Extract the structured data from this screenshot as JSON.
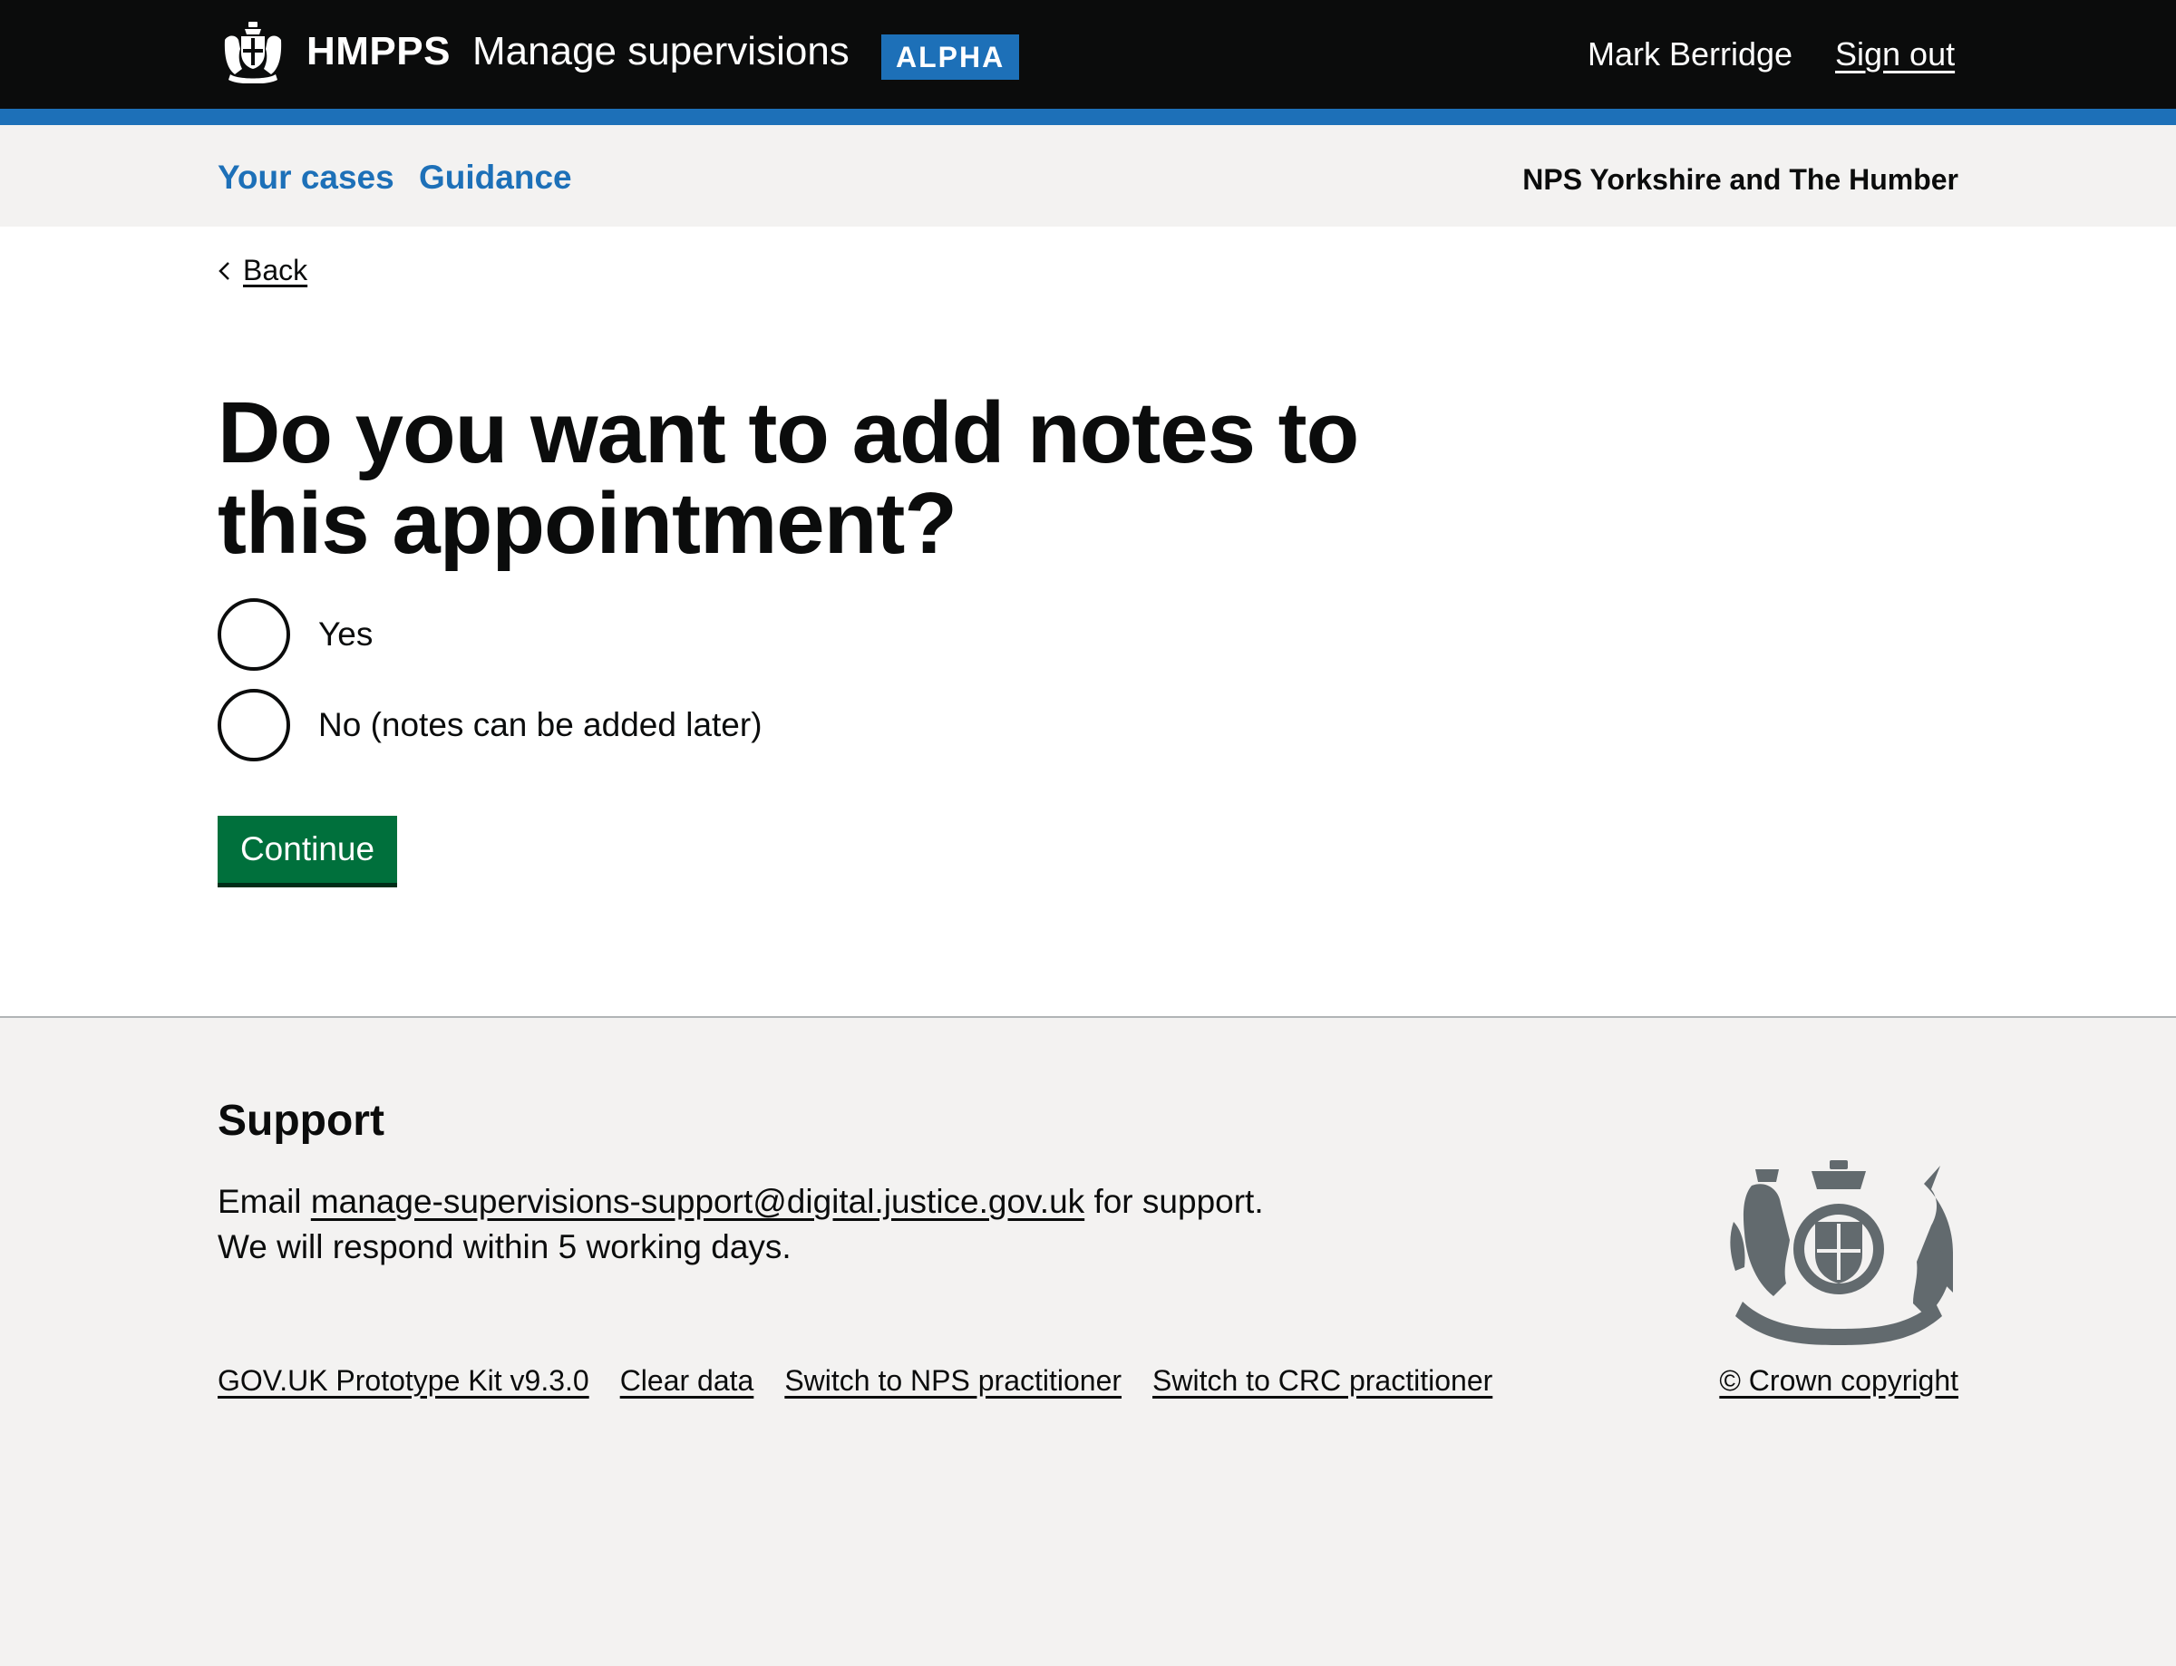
{
  "header": {
    "brand": "HMPPS",
    "service_name": "Manage supervisions",
    "phase_tag": "ALPHA",
    "user_name": "Mark Berridge",
    "sign_out": "Sign out"
  },
  "nav": {
    "items": [
      {
        "label": "Your cases"
      },
      {
        "label": "Guidance"
      }
    ],
    "region": "NPS Yorkshire and The Humber"
  },
  "main": {
    "back_label": "Back",
    "title": "Do you want to add notes to this appointment?",
    "options": [
      {
        "label": "Yes",
        "selected": false
      },
      {
        "label": "No (notes can be added later)",
        "selected": false
      }
    ],
    "continue_label": "Continue"
  },
  "footer": {
    "support_heading": "Support",
    "support_email_prefix": "Email ",
    "support_email": "manage-supervisions-support@digital.justice.gov.uk",
    "support_email_suffix": " for support.",
    "support_response": "We will respond within 5 working days.",
    "links": [
      {
        "label": "GOV.UK Prototype Kit v9.3.0"
      },
      {
        "label": "Clear data"
      },
      {
        "label": "Switch to NPS practitioner"
      },
      {
        "label": "Switch to CRC practitioner"
      }
    ],
    "copyright": "© Crown copyright"
  },
  "colors": {
    "header_bg": "#0b0c0c",
    "brand_blue": "#1d70b8",
    "button_green": "#00703c",
    "footer_bg": "#f3f2f1"
  },
  "icons": {
    "crest": "royal-coat-of-arms-icon",
    "back": "chevron-left-icon"
  }
}
